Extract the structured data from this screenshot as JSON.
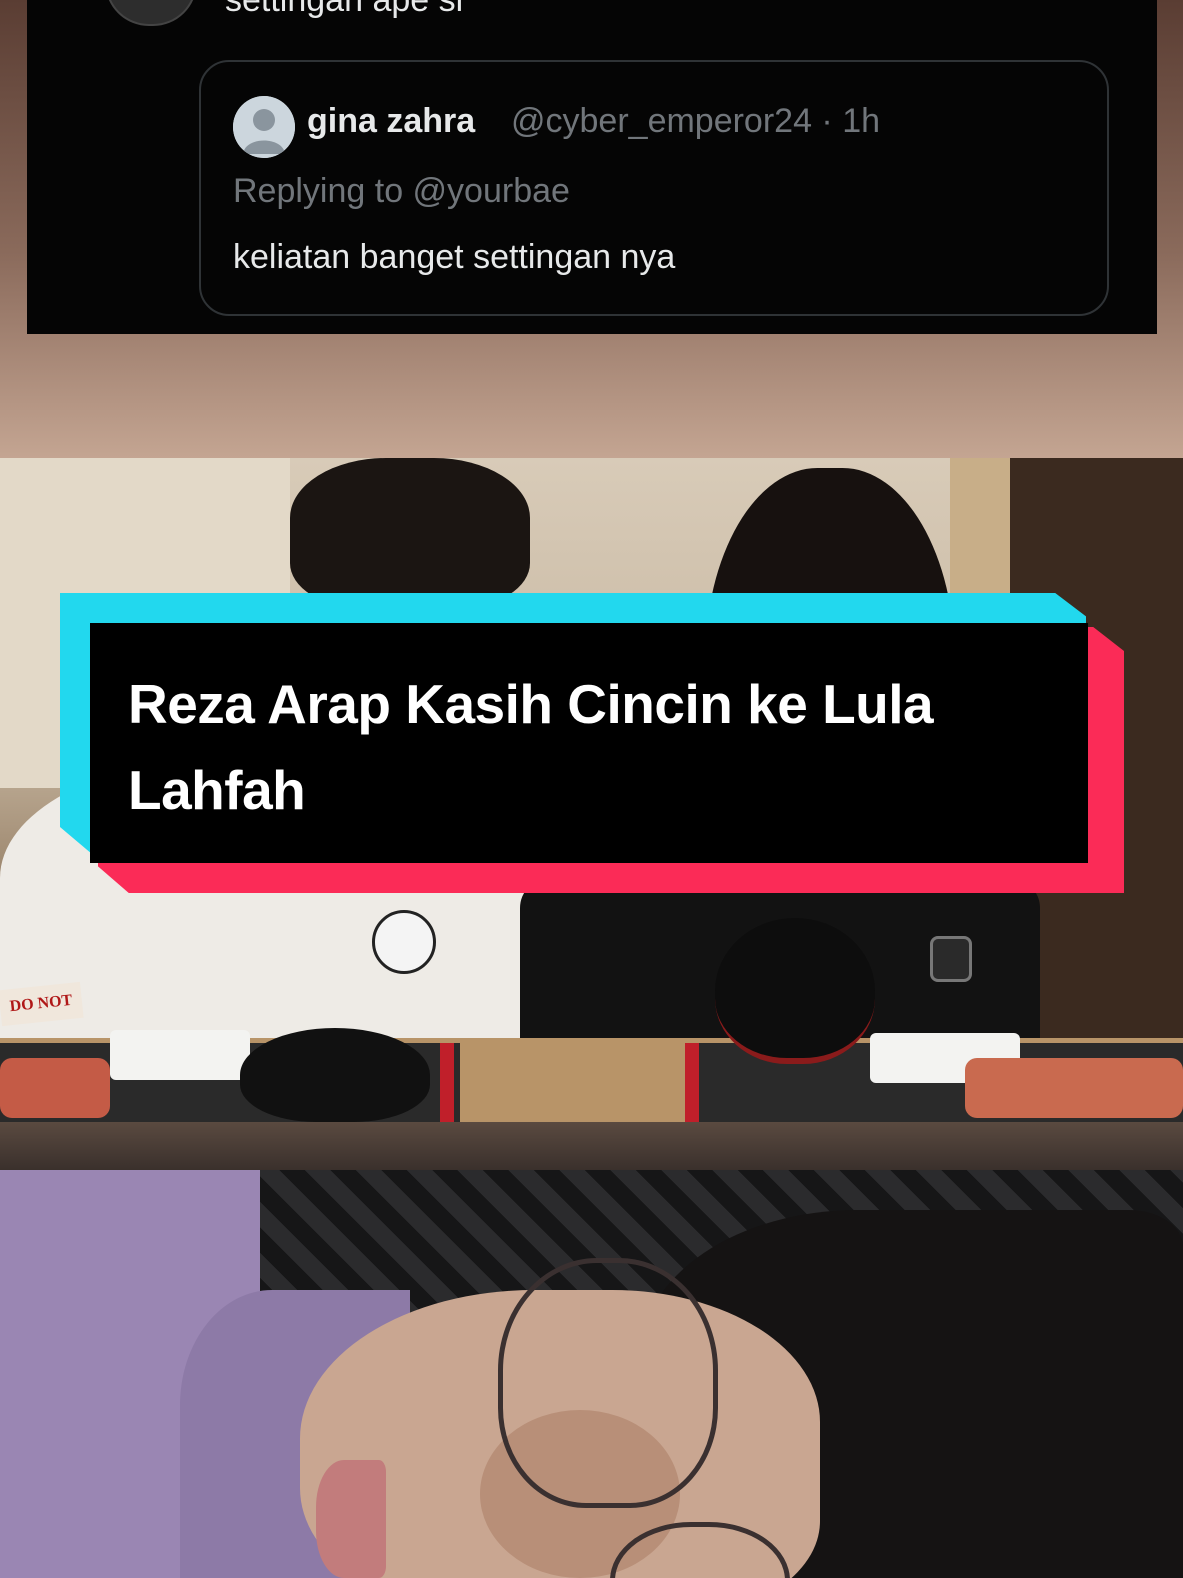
{
  "tweet": {
    "top_text": "settingan ape si",
    "quoted": {
      "name": "gina zahra",
      "handle_time": "@cyber_emperor24 · 1h",
      "replying_to": "Replying to @yourbae",
      "body": "keliatan banget settingan nya"
    }
  },
  "video": {
    "sign_text": "DO NOT"
  },
  "caption": {
    "text": "Reza Arap Kasih Cincin ke Lula Lahfah"
  },
  "colors": {
    "caption_cyan": "#22d8ee",
    "caption_red": "#fb2b57",
    "caption_bg": "#000000",
    "tweet_bg": "#050505",
    "muted_text": "#71767b"
  },
  "icons": {
    "quote_avatar": "default-user-avatar-icon"
  }
}
